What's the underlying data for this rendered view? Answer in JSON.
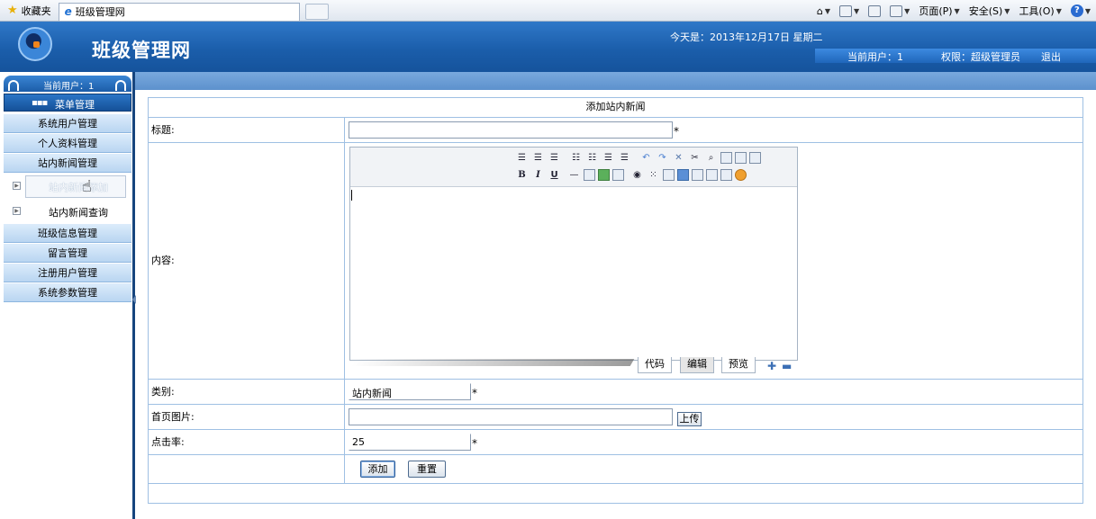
{
  "browser": {
    "favorites": "收藏夹",
    "tab_title": "班级管理网",
    "menu_page": "页面(P)",
    "menu_safety": "安全(S)",
    "menu_tools": "工具(O)"
  },
  "header": {
    "site_title": "班级管理网",
    "date_line": "今天是：2013年12月17日 星期二",
    "current_user": "当前用户：1",
    "permission": "权限：超级管理员",
    "logout": "退出"
  },
  "sidebar": {
    "user_label": "当前用户：1",
    "menu_title": "菜单管理",
    "items_top": [
      "系统用户管理",
      "个人资料管理",
      "站内新闻管理"
    ],
    "sub_items": [
      "站内新闻添加",
      "站内新闻查询"
    ],
    "items_bottom": [
      "班级信息管理",
      "留言管理",
      "注册用户管理",
      "系统参数管理"
    ]
  },
  "form": {
    "heading": "添加站内新闻",
    "title_label": "标题:",
    "title_value": "",
    "content_label": "内容:",
    "category_label": "类别:",
    "category_value": "站内新闻",
    "image_label": "首页图片:",
    "image_value": "",
    "upload_label": "上传",
    "hits_label": "点击率:",
    "hits_value": "25",
    "required_mark": "*",
    "submit_label": "添加",
    "reset_label": "重置"
  },
  "editor": {
    "tab_code": "代码",
    "tab_edit": "编辑",
    "tab_preview": "预览"
  }
}
